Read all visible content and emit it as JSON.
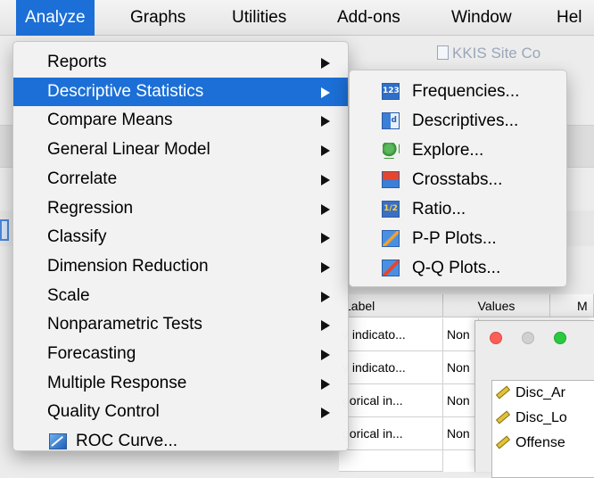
{
  "menubar": {
    "items": [
      "Analyze",
      "Graphs",
      "Utilities",
      "Add-ons",
      "Window",
      "Hel"
    ]
  },
  "background": {
    "window_title": "KKIS Site Co",
    "table_headers": [
      "Label",
      "Values",
      "M"
    ],
    "rows": [
      {
        "label": "y indicato...",
        "values": "Non"
      },
      {
        "label": "y indicato...",
        "values": "Non"
      },
      {
        "label": "gorical in...",
        "values": "Non"
      },
      {
        "label": "gorical in...",
        "values": "Non"
      }
    ],
    "dialog_items": [
      "Disc_Ar",
      "Disc_Lo",
      "Offense"
    ]
  },
  "analyze_menu": {
    "items": [
      {
        "label": "Reports",
        "has_submenu": true
      },
      {
        "label": "Descriptive Statistics",
        "has_submenu": true,
        "highlighted": true
      },
      {
        "label": "Compare Means",
        "has_submenu": true
      },
      {
        "label": "General Linear Model",
        "has_submenu": true
      },
      {
        "label": "Correlate",
        "has_submenu": true
      },
      {
        "label": "Regression",
        "has_submenu": true
      },
      {
        "label": "Classify",
        "has_submenu": true
      },
      {
        "label": "Dimension Reduction",
        "has_submenu": true
      },
      {
        "label": "Scale",
        "has_submenu": true
      },
      {
        "label": "Nonparametric Tests",
        "has_submenu": true
      },
      {
        "label": "Forecasting",
        "has_submenu": true
      },
      {
        "label": "Multiple Response",
        "has_submenu": true
      },
      {
        "label": "Quality Control",
        "has_submenu": true
      },
      {
        "label": "ROC Curve...",
        "has_submenu": false,
        "icon": "roc-curve-icon"
      }
    ]
  },
  "descriptive_submenu": {
    "items": [
      {
        "label": "Frequencies...",
        "icon": "frequencies-icon",
        "glyph": "123"
      },
      {
        "label": "Descriptives...",
        "icon": "descriptives-icon",
        "glyph": "d"
      },
      {
        "label": "Explore...",
        "icon": "explore-icon",
        "glyph": ""
      },
      {
        "label": "Crosstabs...",
        "icon": "crosstabs-icon",
        "glyph": ""
      },
      {
        "label": "Ratio...",
        "icon": "ratio-icon",
        "glyph": "1/2"
      },
      {
        "label": "P-P Plots...",
        "icon": "pp-plots-icon",
        "glyph": ""
      },
      {
        "label": "Q-Q Plots...",
        "icon": "qq-plots-icon",
        "glyph": ""
      }
    ]
  },
  "colors": {
    "highlight": "#1c6fd6",
    "traffic_close": "#fc5f57",
    "traffic_min": "#d0d0d0",
    "traffic_max": "#29c940"
  }
}
